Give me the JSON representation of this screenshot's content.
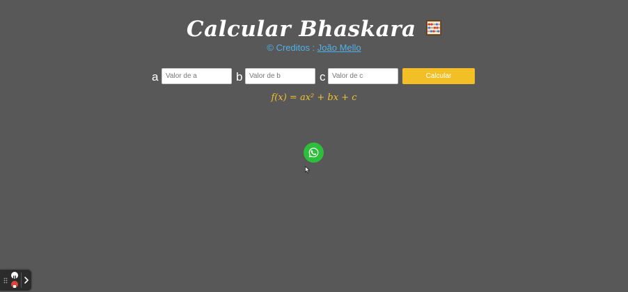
{
  "header": {
    "title": "Calcular Bhaskara",
    "title_icon": "abacus-icon",
    "credits_prefix": "© Creditos : ",
    "credits_author": "João Mello"
  },
  "form": {
    "fields": [
      {
        "label": "a",
        "placeholder": "Valor de a",
        "value": ""
      },
      {
        "label": "b",
        "placeholder": "Valor de b",
        "value": ""
      },
      {
        "label": "c",
        "placeholder": "Valor de c",
        "value": ""
      }
    ],
    "submit_label": "Calcular"
  },
  "formula": "f(x) = ax² + bx + c",
  "floating": {
    "whatsapp_icon": "whatsapp-icon"
  },
  "recorder": {
    "pause_icon": "pause-icon",
    "stop_icon": "stop-icon",
    "expand_icon": "chevron-right-icon"
  },
  "colors": {
    "background": "#585858",
    "title": "#ffffff",
    "credits": "#4fb2ea",
    "button": "#f2bf26",
    "formula": "#f2c233",
    "whatsapp": "#2fbe3c"
  }
}
